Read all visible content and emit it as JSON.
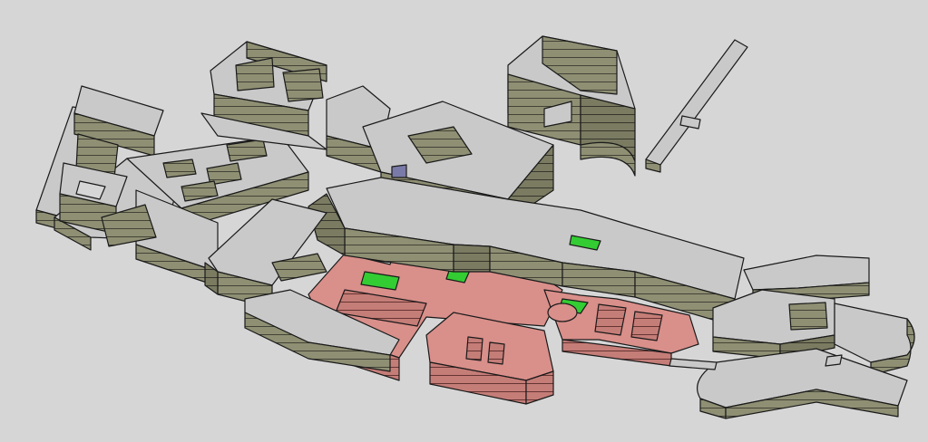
{
  "model": {
    "colors": {
      "background": "#d6d6d6",
      "roof_grey": "#c9c9c9",
      "wall_olive": "#8f8f74",
      "wall_olive_dark": "#7b7b62",
      "roof_red": "#d98f8a",
      "wall_red": "#c57d78",
      "courtyard_green": "#33cc33",
      "accent_blue": "#7a7aa8",
      "outline": "#1a1a1a"
    }
  }
}
